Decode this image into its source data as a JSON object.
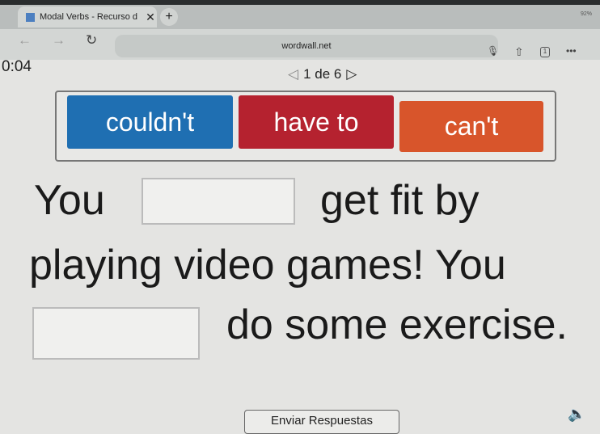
{
  "browser": {
    "tab_title": "Modal Verbs - Recurso d",
    "close_tab": "✕",
    "new_tab": "+",
    "status": "92%",
    "url": "wordwall.net"
  },
  "game": {
    "timer": "0:04",
    "page": "1 de 6",
    "prev_icon": "◁",
    "next_icon": "▷",
    "options": [
      {
        "label": "couldn't",
        "color": "#1f6fb2"
      },
      {
        "label": "have to",
        "color": "#b5222f"
      },
      {
        "label": "can't",
        "color": "#d8552b"
      }
    ],
    "sentence": {
      "part1": "You",
      "part2": "get fit by",
      "part3": "playing video games! You",
      "part4": "do some exercise."
    },
    "submit_label": "Enviar Respuestas"
  }
}
